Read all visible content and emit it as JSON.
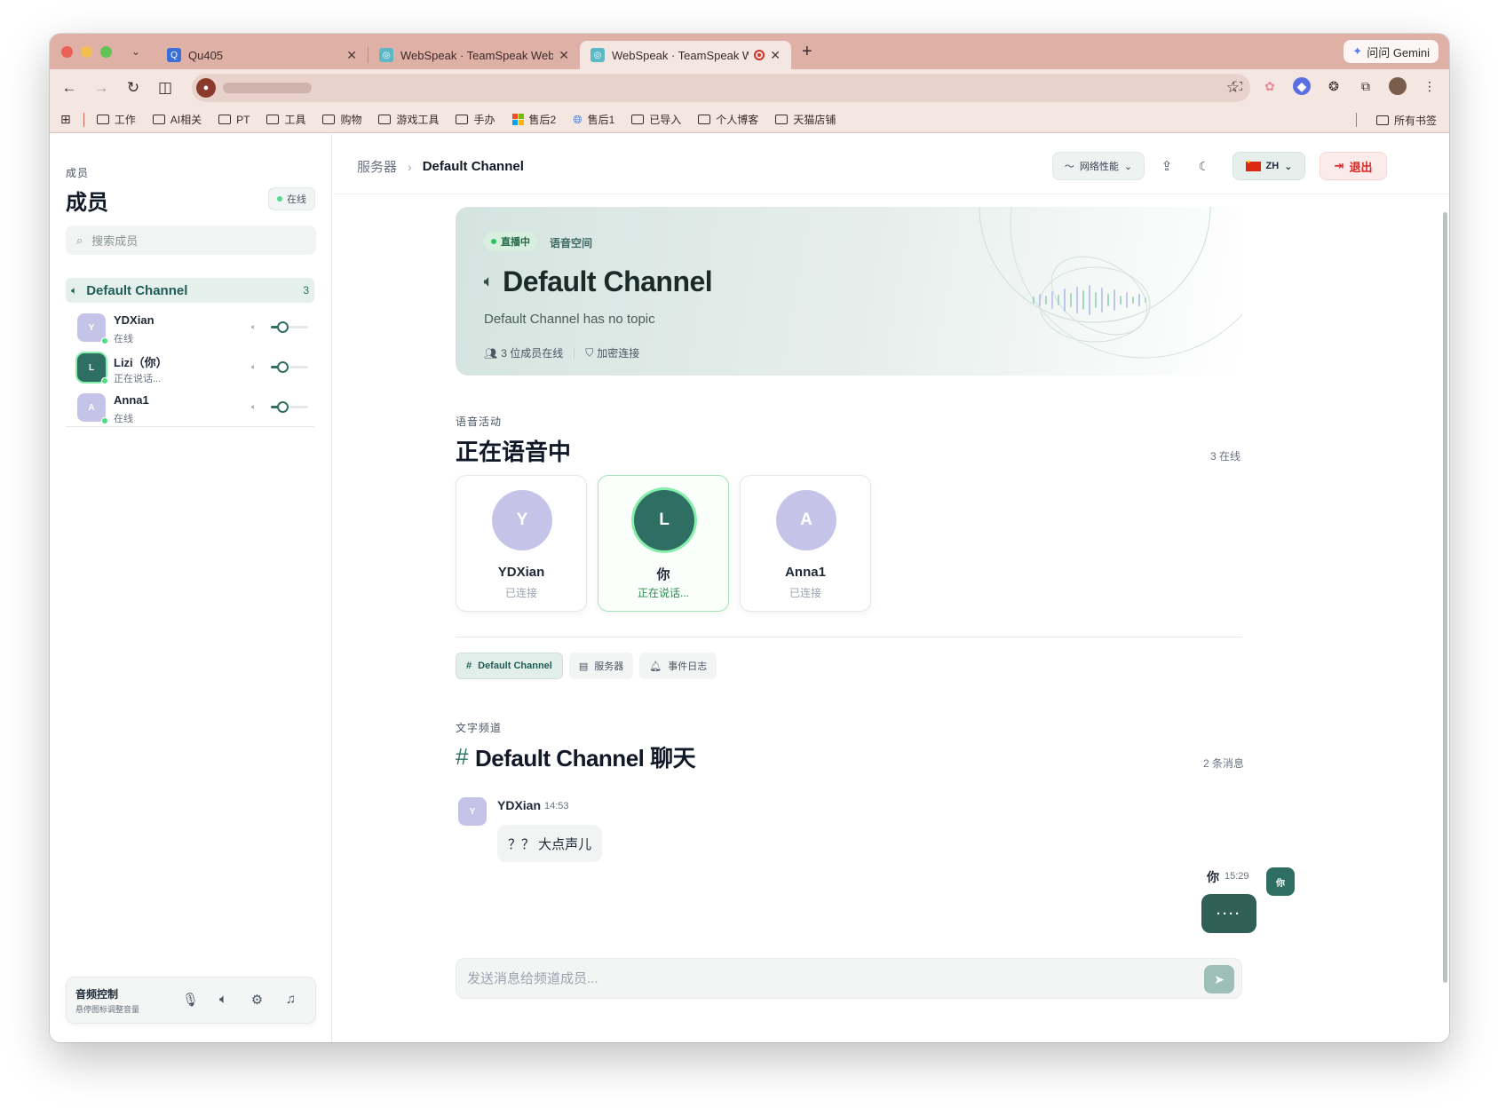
{
  "browser": {
    "tabs": [
      {
        "title": "Qu405",
        "favicon_color": "#3b6fd8"
      },
      {
        "title": "WebSpeak · TeamSpeak Web",
        "favicon_color": "#5cb8c4"
      },
      {
        "title": "WebSpeak · TeamSpeak W",
        "favicon_color": "#5cb8c4"
      }
    ],
    "gemini_label": "问问 Gemini",
    "bookmarks": [
      {
        "label": "工作",
        "icon": "folder"
      },
      {
        "label": "AI相关",
        "icon": "folder"
      },
      {
        "label": "PT",
        "icon": "folder"
      },
      {
        "label": "工具",
        "icon": "folder"
      },
      {
        "label": "购物",
        "icon": "folder"
      },
      {
        "label": "游戏工具",
        "icon": "folder"
      },
      {
        "label": "手办",
        "icon": "folder"
      },
      {
        "label": "售后2",
        "icon": "microsoft"
      },
      {
        "label": "售后1",
        "icon": "globe"
      },
      {
        "label": "已导入",
        "icon": "folder"
      },
      {
        "label": "个人博客",
        "icon": "folder"
      },
      {
        "label": "天猫店铺",
        "icon": "folder"
      }
    ],
    "all_bookmarks_label": "所有书签",
    "chrome_color": "#dfb0a5",
    "toolbar_color": "#f4e6e1"
  },
  "sidebar": {
    "kicker": "成员",
    "title": "成员",
    "status_pill": "在线",
    "search_placeholder": "搜索成员",
    "channel": {
      "name": "Default Channel",
      "count": "3"
    },
    "members": [
      {
        "initial": "Y",
        "name": "YDXian",
        "status": "在线",
        "avatar_color": "#c5c4e8",
        "volume": 0.3,
        "speaking": false
      },
      {
        "initial": "L",
        "name": "Lizi（你）",
        "status": "正在说话...",
        "avatar_color": "#2f6f63",
        "volume": 0.3,
        "speaking": true
      },
      {
        "initial": "A",
        "name": "Anna1",
        "status": "在线",
        "avatar_color": "#c5c4e8",
        "volume": 0.3,
        "speaking": false
      }
    ],
    "audio": {
      "title": "音频控制",
      "subtitle": "悬停图标调整音量"
    }
  },
  "topbar": {
    "breadcrumb": [
      "服务器",
      "Default Channel"
    ],
    "network_label": "网络性能",
    "lang_label": "ZH",
    "exit_label": "退出"
  },
  "hero": {
    "live_label": "直播中",
    "type_label": "语音空间",
    "title": "Default Channel",
    "topic": "Default Channel has no topic",
    "members_online": "3 位成员在线",
    "encryption": "加密连接"
  },
  "voice": {
    "kicker": "语音活动",
    "title": "正在语音中",
    "count": "3 在线",
    "cards": [
      {
        "initial": "Y",
        "name": "YDXian",
        "status": "已连接",
        "color": "#c5c4e8",
        "speaking": false
      },
      {
        "initial": "L",
        "name": "你",
        "status": "正在说话...",
        "color": "#2f6f63",
        "speaking": true
      },
      {
        "initial": "A",
        "name": "Anna1",
        "status": "已连接",
        "color": "#c5c4e8",
        "speaking": false
      }
    ]
  },
  "panel_tabs": [
    {
      "label": "Default Channel",
      "icon": "hash",
      "active": true
    },
    {
      "label": "服务器",
      "icon": "server",
      "active": false
    },
    {
      "label": "事件日志",
      "icon": "bell",
      "active": false
    }
  ],
  "chat": {
    "kicker": "文字频道",
    "title": "Default Channel 聊天",
    "count": "2 条消息",
    "messages": [
      {
        "initial": "Y",
        "author": "YDXian",
        "time": "14:53",
        "text": "？？ 大点声儿",
        "own": false
      },
      {
        "initial": "你",
        "author": "你",
        "time": "15:29",
        "text": "····",
        "own": true
      }
    ],
    "input_placeholder": "发送消息给频道成员..."
  }
}
